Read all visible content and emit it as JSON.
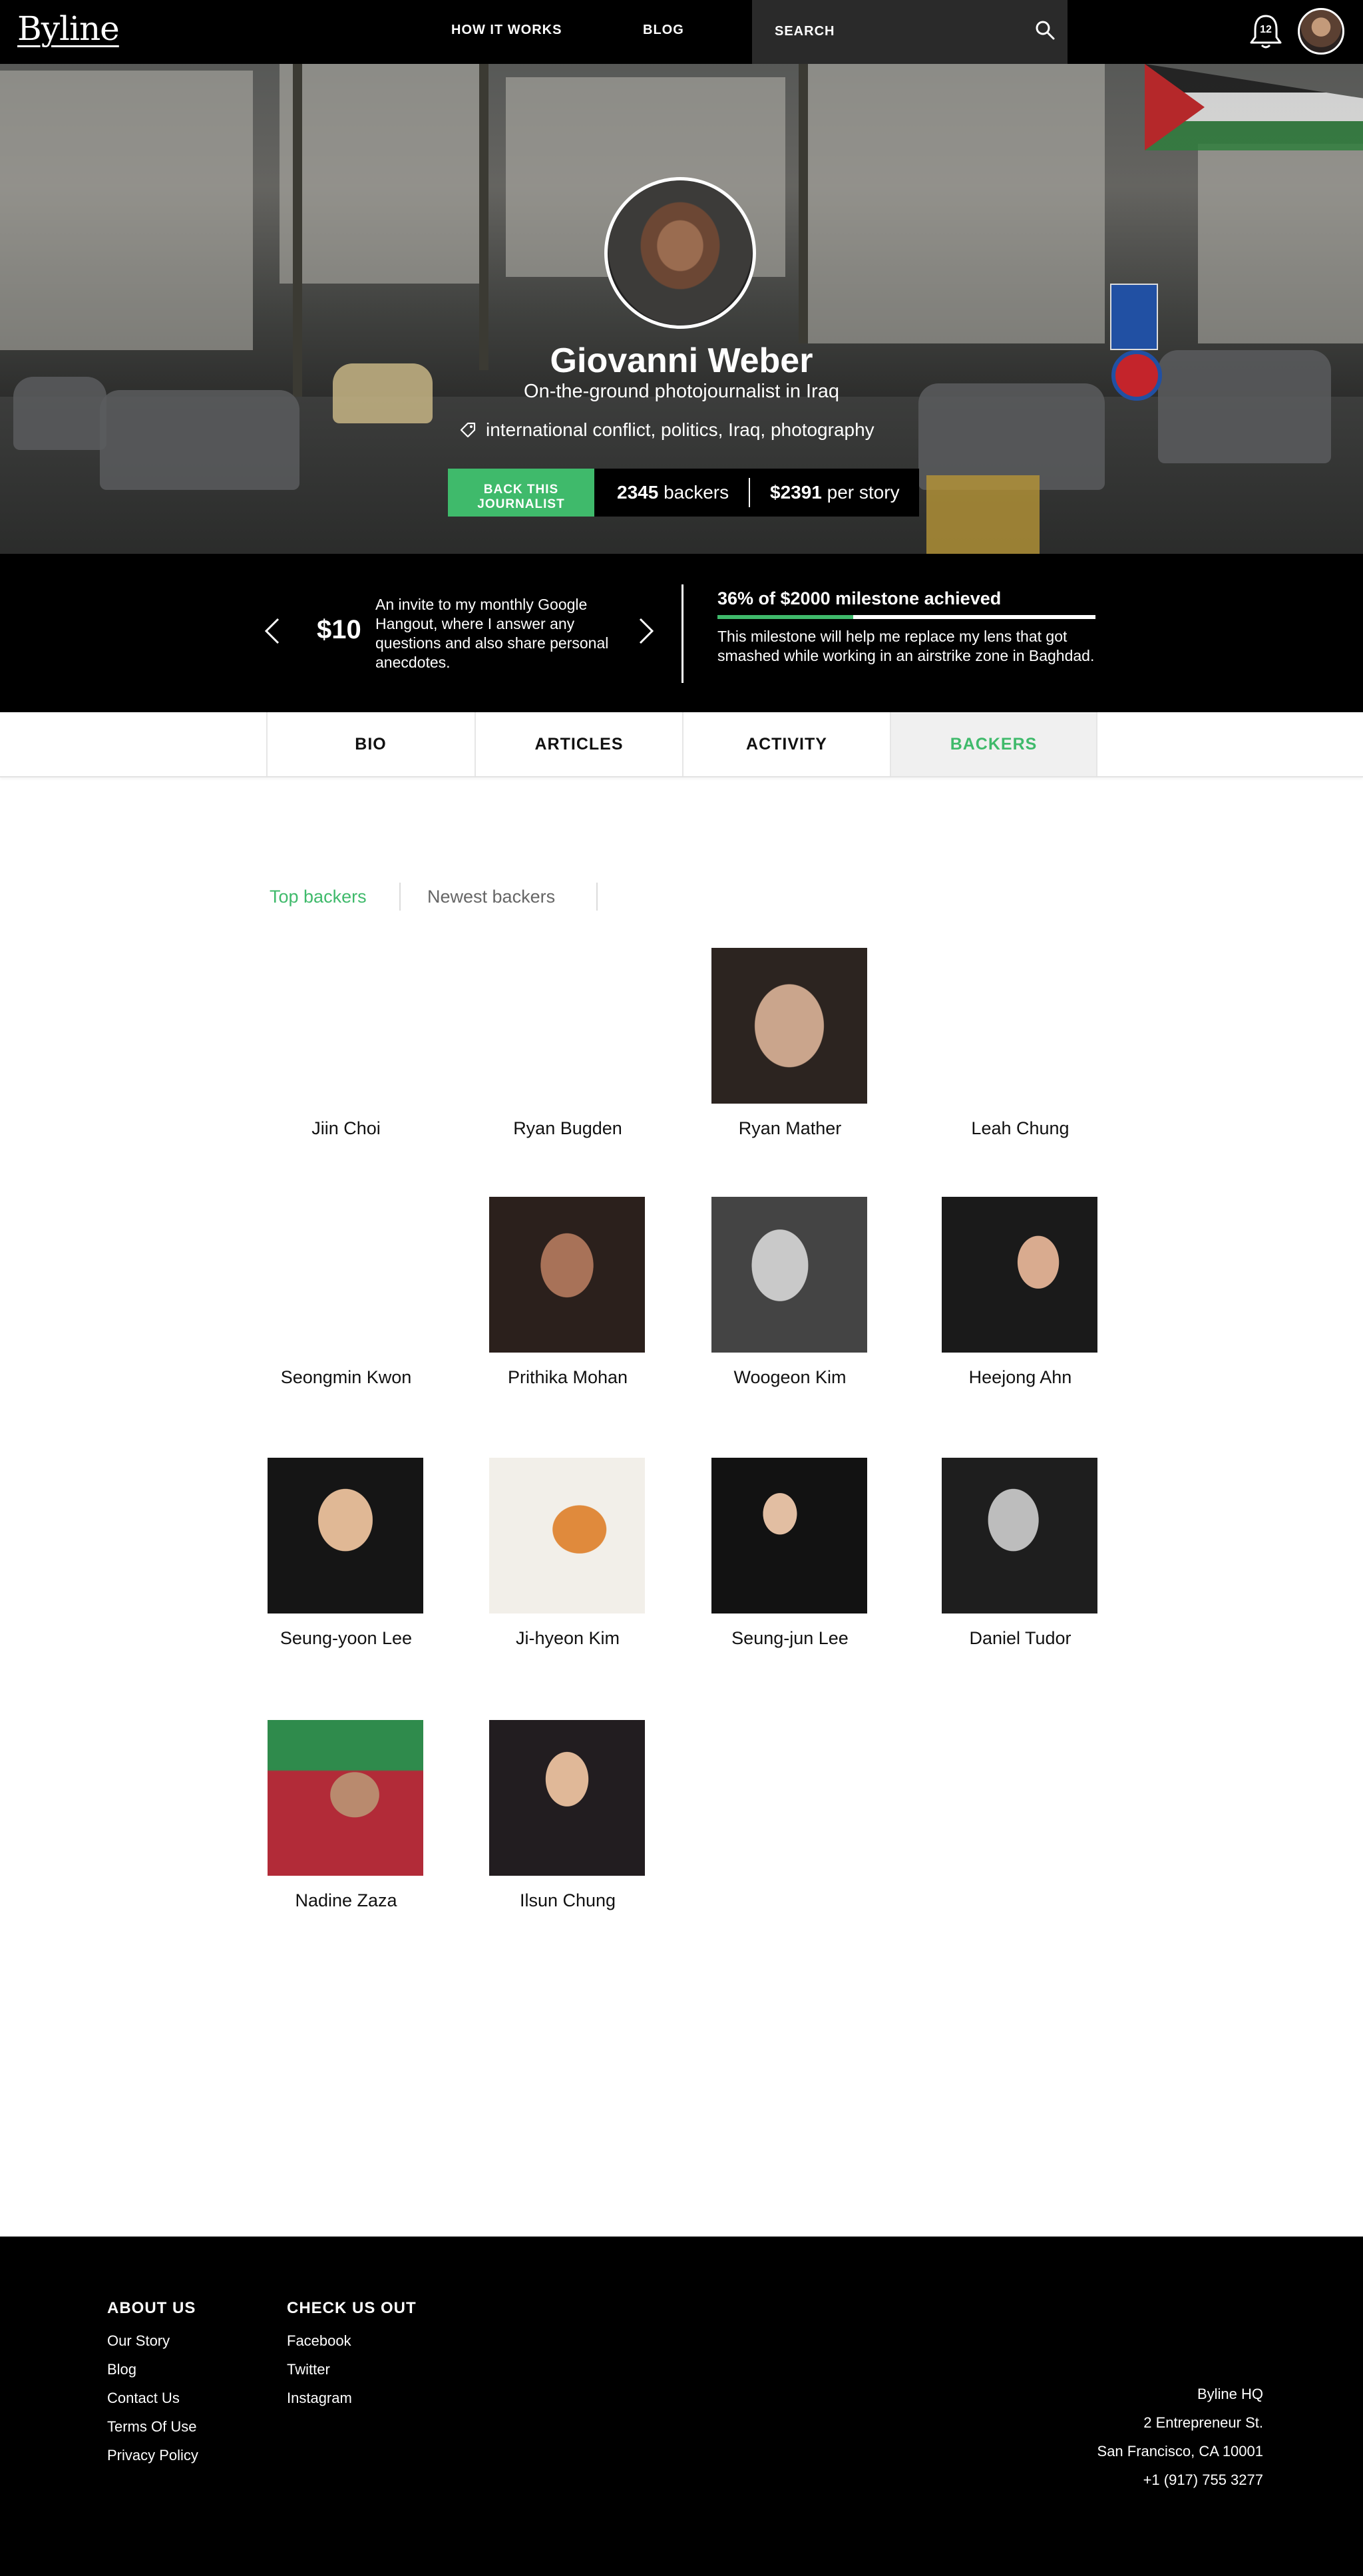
{
  "nav": {
    "logo": "Byline",
    "how_it_works": "HOW IT WORKS",
    "blog": "BLOG",
    "search_placeholder": "SEARCH",
    "notification_count": "12"
  },
  "profile": {
    "name": "Giovanni Weber",
    "subtitle": "On-the-ground photojournalist in Iraq",
    "tags": "international conflict, politics, Iraq, photography",
    "back_button_line1": "BACK THIS",
    "back_button_line2": "JOURNALIST",
    "backers_count": "2345",
    "backers_label": "backers",
    "per_story_amount": "$2391",
    "per_story_label": "per story"
  },
  "milestone": {
    "reward_amount": "$10",
    "reward_text": "An invite to my monthly Google Hangout, where I answer any questions and also share personal anecdotes.",
    "title": "36% of $2000 milestone achieved",
    "progress_fraction": 0.36,
    "description": "This milestone will help me replace my lens that got smashed while working in an airstrike zone in Baghdad."
  },
  "tabs": {
    "bio": "BIO",
    "articles": "ARTICLES",
    "activity": "ACTIVITY",
    "backers": "BACKERS"
  },
  "subtabs": {
    "top": "Top backers",
    "newest": "Newest backers"
  },
  "backers": [
    {
      "name": "Jiin Choi"
    },
    {
      "name": "Ryan Bugden"
    },
    {
      "name": "Ryan Mather"
    },
    {
      "name": "Leah Chung"
    },
    {
      "name": "Seongmin Kwon"
    },
    {
      "name": "Prithika Mohan"
    },
    {
      "name": "Woogeon Kim"
    },
    {
      "name": "Heejong Ahn"
    },
    {
      "name": "Seung-yoon Lee"
    },
    {
      "name": "Ji-hyeon Kim"
    },
    {
      "name": "Seung-jun Lee"
    },
    {
      "name": "Daniel Tudor"
    },
    {
      "name": "Nadine Zaza"
    },
    {
      "name": "Ilsun Chung"
    }
  ],
  "footer": {
    "about_heading": "ABOUT US",
    "about_links": [
      "Our Story",
      "Blog",
      "Contact Us",
      "Terms Of Use",
      "Privacy Policy"
    ],
    "check_heading": "CHECK US OUT",
    "check_links": [
      "Facebook",
      "Twitter",
      "Instagram"
    ],
    "address": [
      "Byline HQ",
      "2 Entrepreneur St.",
      "San Francisco, CA 10001",
      "+1 (917) 755 3277"
    ]
  },
  "colors": {
    "accent": "#3fba6b",
    "dark": "#000000"
  }
}
